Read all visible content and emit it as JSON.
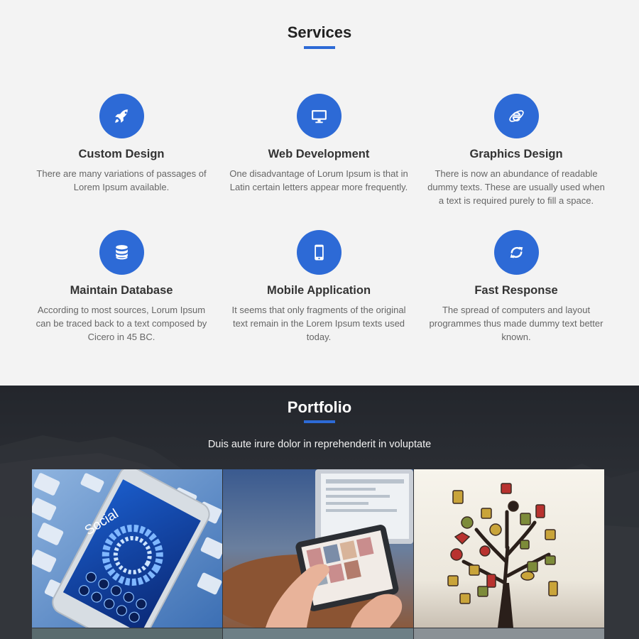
{
  "services": {
    "title": "Services",
    "items": [
      {
        "icon": "rocket-icon",
        "title": "Custom Design",
        "desc": "There are many variations of passages of Lorem Ipsum available."
      },
      {
        "icon": "monitor-icon",
        "title": "Web Development",
        "desc": "One disadvantage of Lorum Ipsum is that in Latin certain letters appear more frequently."
      },
      {
        "icon": "internet-explorer-icon",
        "title": "Graphics Design",
        "desc": "There is now an abundance of readable dummy texts. These are usually used when a text is required purely to fill a space."
      },
      {
        "icon": "database-icon",
        "title": "Maintain Database",
        "desc": "According to most sources, Lorum Ipsum can be traced back to a text composed by Cicero in 45 BC."
      },
      {
        "icon": "mobile-phone-icon",
        "title": "Mobile Application",
        "desc": "It seems that only fragments of the original text remain in the Lorem Ipsum texts used today."
      },
      {
        "icon": "refresh-icon",
        "title": "Fast Response",
        "desc": "The spread of computers and layout programmes thus made dummy text better known."
      }
    ]
  },
  "portfolio": {
    "title": "Portfolio",
    "subtitle": "Duis aute irure dolor in reprehenderit in voluptate",
    "tiles": [
      {
        "image": "smartphone-on-keyboard",
        "label": "Social"
      },
      {
        "image": "hands-using-tablet"
      },
      {
        "image": "social-media-icon-tree"
      }
    ]
  },
  "colors": {
    "accent": "#2d6ad6",
    "services_bg": "#f3f3f3",
    "portfolio_bg": "#26292f"
  }
}
